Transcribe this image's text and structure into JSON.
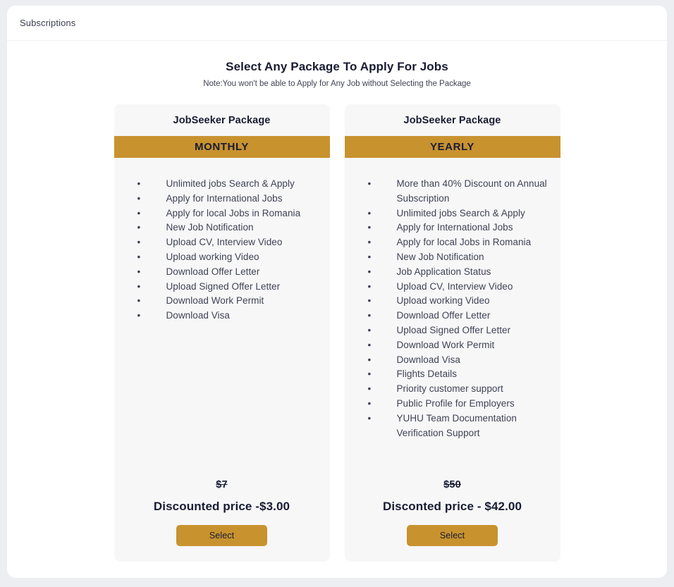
{
  "breadcrumb": {
    "label": "Subscriptions"
  },
  "heading": {
    "title": "Select Any Package To Apply For Jobs",
    "note": "Note:You won't be able to Apply for Any Job without Selecting the Package"
  },
  "theme": {
    "accent": "#c8922f",
    "page_background": "#eceef2",
    "panel_background": "#ffffff",
    "card_background": "#f7f7f8",
    "text_dark": "#181c32",
    "text_body": "#3f4254"
  },
  "packages": [
    {
      "title": "JobSeeker Package",
      "plan": "MONTHLY",
      "features": [
        "Unlimited jobs Search & Apply",
        "Apply for International Jobs",
        "Apply for local Jobs in Romania",
        "New Job Notification",
        "Upload CV, Interview Video",
        "Upload working Video",
        "Download Offer Letter",
        "Upload Signed Offer Letter",
        "Download Work Permit",
        "Download Visa"
      ],
      "price_original": "$7",
      "price_discounted": "Discounted price -$3.00",
      "select_label": "Select"
    },
    {
      "title": "JobSeeker Package",
      "plan": "YEARLY",
      "features": [
        "More than 40% Discount on Annual Subscription",
        "Unlimited jobs Search & Apply",
        "Apply for International Jobs",
        "Apply for local Jobs in Romania",
        "New Job Notification",
        "Job Application Status",
        "Upload CV, Interview Video",
        "Upload working Video",
        "Download Offer Letter",
        "Upload Signed Offer Letter",
        "Download Work Permit",
        "Download Visa",
        "Flights Details",
        "Priority customer support",
        "Public Profile for Employers",
        "YUHU Team Documentation Verification Support"
      ],
      "price_original": "$50",
      "price_discounted": "Disconted price - $42.00",
      "select_label": "Select"
    }
  ]
}
